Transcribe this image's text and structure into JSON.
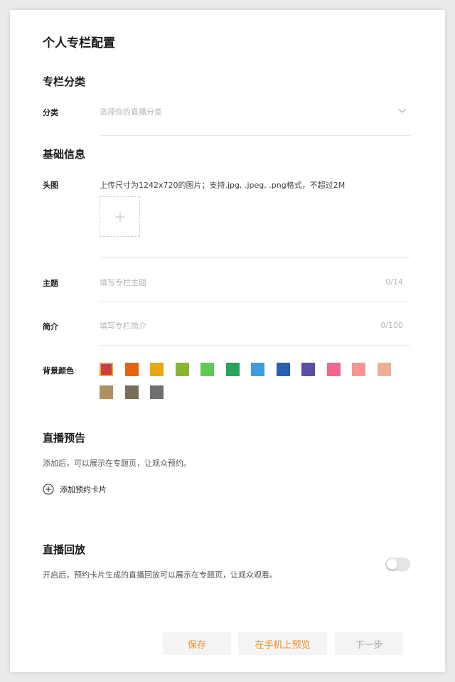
{
  "page": {
    "title": "个人专栏配置"
  },
  "category_section": {
    "title": "专栏分类",
    "label": "分类",
    "placeholder": "选择你的直播分类"
  },
  "basic_info": {
    "title": "基础信息",
    "cover": {
      "label": "头图",
      "hint": "上传尺寸为1242x720的图片；支持.jpg, .jpeg, .png格式，不超过2M"
    },
    "topic": {
      "label": "主题",
      "placeholder": "填写专栏主题",
      "counter": "0/14"
    },
    "intro": {
      "label": "简介",
      "placeholder": "填写专栏简介",
      "counter": "0/100"
    },
    "bg_color": {
      "label": "背景颜色",
      "selected_index": 0,
      "colors": [
        "#c8413b",
        "#e2640f",
        "#e9a712",
        "#8ab534",
        "#5ec954",
        "#29a35a",
        "#3f9ae0",
        "#2a5faf",
        "#5b4ea3",
        "#f06890",
        "#f79592",
        "#eeae98",
        "#ad9165",
        "#7a6b5a",
        "#6f6f6f"
      ]
    }
  },
  "live_preview": {
    "title": "直播预告",
    "desc": "添加后，可以展示在专题页，让观众预约。",
    "add_label": "添加预约卡片"
  },
  "live_replay": {
    "title": "直播回放",
    "desc": "开启后，预约卡片生成的直播回放可以展示在专题页，让观众观看。",
    "toggle_on": false
  },
  "footer": {
    "save": "保存",
    "preview_mobile": "在手机上预览",
    "next": "下一步"
  }
}
